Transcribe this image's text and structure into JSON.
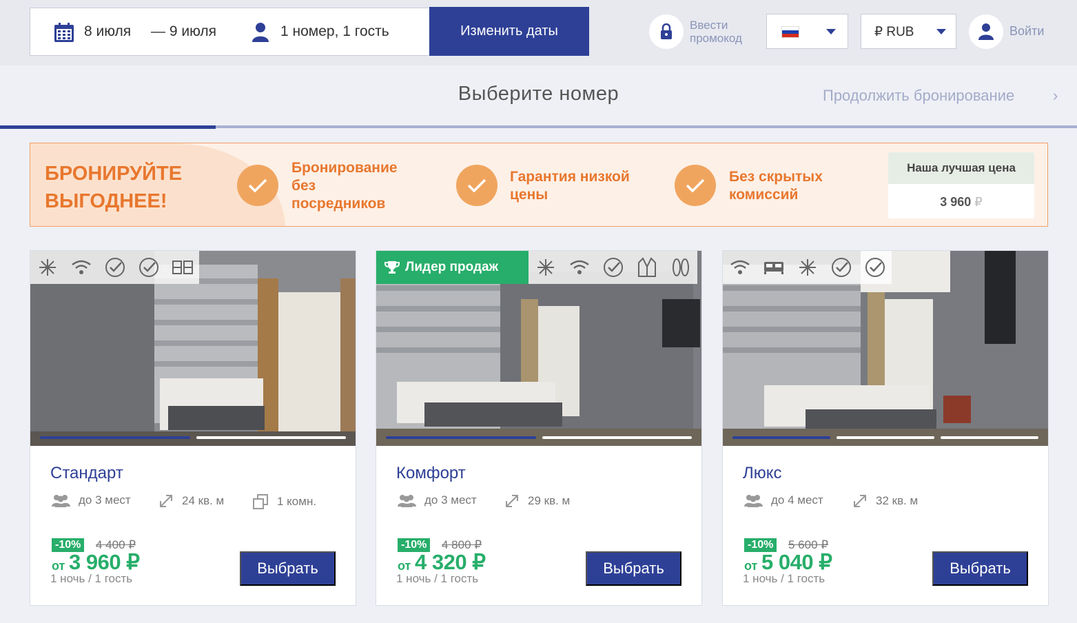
{
  "search": {
    "date_from": "8 июля",
    "date_to": "— 9 июля",
    "guests": "1 номер, 1 гость",
    "change_button": "Изменить даты"
  },
  "header": {
    "promo_line1": "Ввести",
    "promo_line2": "промокод",
    "language_flag": "ru-flag-icon",
    "currency": "₽ RUB",
    "login": "Войти"
  },
  "step": {
    "title": "Выберите номер",
    "continue": "Продолжить бронирование",
    "continue_chevron": "›",
    "progress": 0.2
  },
  "banner": {
    "headline_line1": "БРОНИРУЙТЕ",
    "headline_line2": "ВЫГОДНЕЕ!",
    "features": [
      {
        "line1": "Бронирование",
        "line2": "без",
        "line3": "посредников"
      },
      {
        "line1": "Гарантия низкой",
        "line2": "цены"
      },
      {
        "line1": "Без скрытых",
        "line2": "комиссий"
      }
    ],
    "best_price_label": "Наша лучшая цена",
    "best_price_value": "3 960",
    "currency_sign": "₽"
  },
  "rooms": [
    {
      "name": "Стандарт",
      "capacity": "до 3 мест",
      "area": "24 кв. м",
      "rooms": "1 комн.",
      "discount": "-10%",
      "old_price": "4 400 ₽",
      "from": "от",
      "price": "3 960 ₽",
      "per": "1 ночь / 1 гость",
      "select": "Выбрать",
      "amenities": [
        "snowflake-icon",
        "wifi-icon",
        "check-circle-icon",
        "check-circle-icon",
        "twin-beds-icon"
      ]
    },
    {
      "name": "Комфорт",
      "badge": "Лидер продаж",
      "capacity": "до 3 мест",
      "area": "29 кв. м",
      "discount": "-10%",
      "old_price": "4 800 ₽",
      "from": "от",
      "price": "4 320 ₽",
      "per": "1 ночь / 1 гость",
      "select": "Выбрать",
      "amenities": [
        "snowflake-icon",
        "wifi-icon",
        "check-circle-icon",
        "bathrobe-icon",
        "slippers-icon"
      ]
    },
    {
      "name": "Люкс",
      "capacity": "до 4 мест",
      "area": "32 кв. м",
      "discount": "-10%",
      "old_price": "5 600 ₽",
      "from": "от",
      "price": "5 040 ₽",
      "per": "1 ночь / 1 гость",
      "select": "Выбрать",
      "amenities": [
        "wifi-icon",
        "bed-icon",
        "snowflake-icon",
        "check-circle-icon",
        "check-circle-icon"
      ]
    }
  ],
  "colors": {
    "brand": "#2e4096",
    "accent": "#e8772e",
    "success": "#27ae6a"
  }
}
